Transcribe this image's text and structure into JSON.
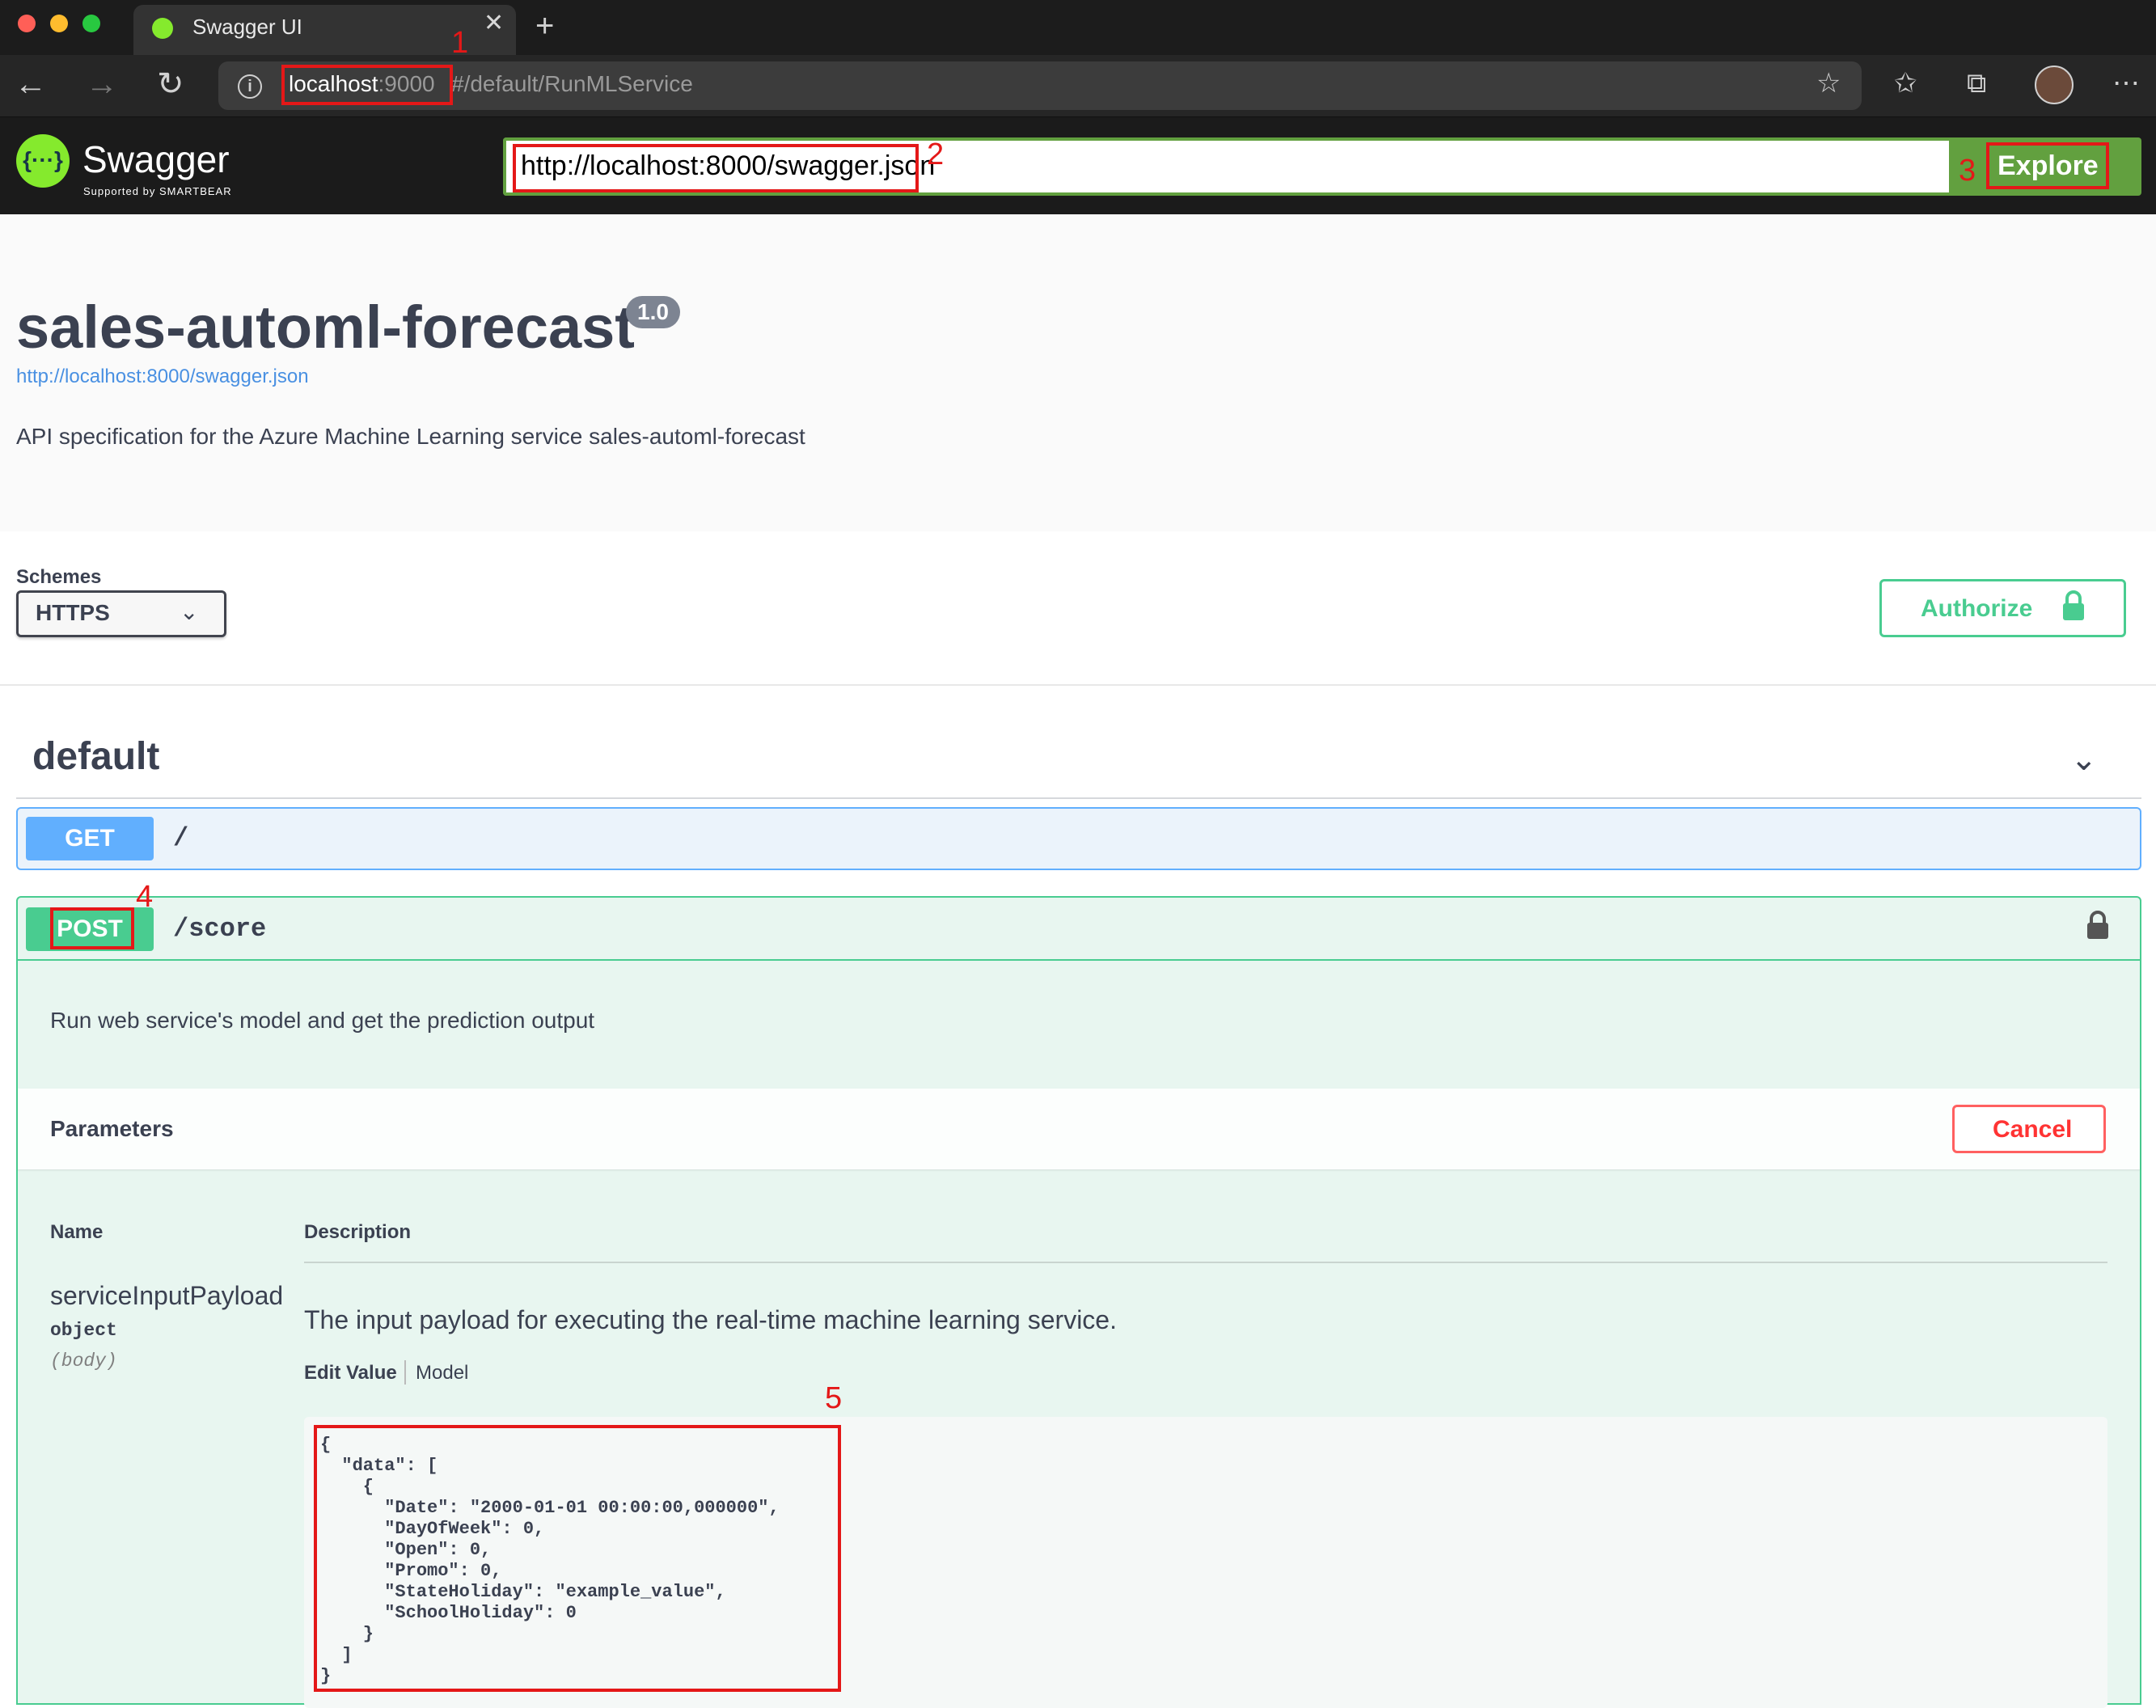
{
  "browser": {
    "tab_title": "Swagger UI",
    "url_host": "localhost",
    "url_port": ":9000",
    "url_rest": "#/default/RunMLService"
  },
  "topbar": {
    "brand": "Swagger",
    "brand_sub": "Supported by SMARTBEAR",
    "logo_glyph": "{···}",
    "spec_url": "http://localhost:8000/swagger.json",
    "explore_label": "Explore"
  },
  "info": {
    "title": "sales-automl-forecast",
    "version": "1.0",
    "spec_link": "http://localhost:8000/swagger.json",
    "description": "API specification for the Azure Machine Learning service sales-automl-forecast"
  },
  "schemes": {
    "label": "Schemes",
    "selected": "HTTPS"
  },
  "authorize_label": "Authorize",
  "tag": {
    "name": "default"
  },
  "operations": {
    "get": {
      "method": "GET",
      "path": "/"
    },
    "post": {
      "method": "POST",
      "path": "/score",
      "summary": "Run web service's model and get the prediction output",
      "parameters_title": "Parameters",
      "cancel_label": "Cancel",
      "col_name": "Name",
      "col_description": "Description",
      "param": {
        "name": "serviceInputPayload",
        "type": "object",
        "in": "(body)",
        "description": "The input payload for executing the real-time machine learning service.",
        "edit_value_tab": "Edit Value",
        "model_tab": "Model",
        "body": "{\n  \"data\": [\n    {\n      \"Date\": \"2000-01-01 00:00:00,000000\",\n      \"DayOfWeek\": 0,\n      \"Open\": 0,\n      \"Promo\": 0,\n      \"StateHoliday\": \"example_value\",\n      \"SchoolHoliday\": 0\n    }\n  ]\n}"
      }
    }
  },
  "annotations": [
    "1",
    "2",
    "3",
    "4",
    "5"
  ],
  "colors": {
    "swagger_green": "#62a03f",
    "get_blue": "#61affe",
    "post_green": "#49cc90",
    "cancel_red": "#ff3333",
    "annotation_red": "#e41818"
  },
  "icons": [
    "favicon-icon",
    "close-icon",
    "plus-icon",
    "back-arrow-icon",
    "forward-arrow-icon",
    "reload-icon",
    "info-icon",
    "favorite-add-icon",
    "favorites-icon",
    "collections-icon",
    "profile-avatar",
    "more-icon",
    "lock-icon",
    "chevron-down-icon"
  ]
}
